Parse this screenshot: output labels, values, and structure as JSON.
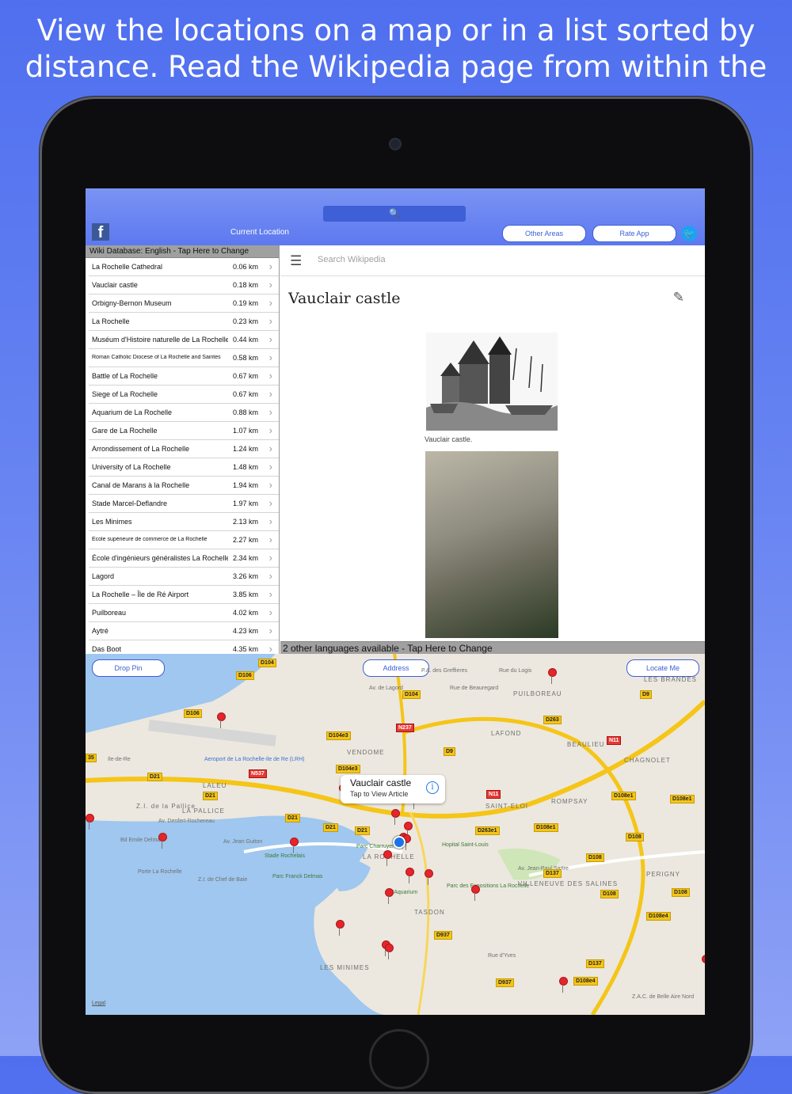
{
  "promo": {
    "line1": "View the locations on a map or in a list sorted by",
    "line2": "distance. Read the Wikipedia page from within the app."
  },
  "toolbar": {
    "facebook_icon": "f",
    "search_glyph": "🔍",
    "current_location": "Current Location",
    "other_areas": "Other Areas",
    "rate_app": "Rate App",
    "twitter_icon": "🐦"
  },
  "list": {
    "database_bar": "Wiki Database: English - Tap Here to Change",
    "items": [
      {
        "name": "La Rochelle Cathedral",
        "distance": "0.06 km"
      },
      {
        "name": "Vauclair castle",
        "distance": "0.18 km"
      },
      {
        "name": "Orbigny-Bernon Museum",
        "distance": "0.19 km"
      },
      {
        "name": "La Rochelle",
        "distance": "0.23 km"
      },
      {
        "name": "Muséum d'Histoire naturelle de La Rochelle",
        "distance": "0.44 km"
      },
      {
        "name": "Roman Catholic Diocese of La Rochelle and Saintes",
        "distance": "0.58 km",
        "small": true
      },
      {
        "name": "Battle of La Rochelle",
        "distance": "0.67 km"
      },
      {
        "name": "Siege of La Rochelle",
        "distance": "0.67 km"
      },
      {
        "name": "Aquarium de La Rochelle",
        "distance": "0.88 km"
      },
      {
        "name": "Gare de La Rochelle",
        "distance": "1.07 km"
      },
      {
        "name": "Arrondissement of La Rochelle",
        "distance": "1.24 km"
      },
      {
        "name": "University of La Rochelle",
        "distance": "1.48 km"
      },
      {
        "name": "Canal de Marans à la Rochelle",
        "distance": "1.94 km"
      },
      {
        "name": "Stade Marcel-Deflandre",
        "distance": "1.97 km"
      },
      {
        "name": "Les Minimes",
        "distance": "2.13 km"
      },
      {
        "name": "École supérieure de commerce de La Rochelle",
        "distance": "2.27 km",
        "small": true
      },
      {
        "name": "École d'ingénieurs généralistes La Rochelle",
        "distance": "2.34 km"
      },
      {
        "name": "Lagord",
        "distance": "3.26 km"
      },
      {
        "name": "La Rochelle – Île de Ré Airport",
        "distance": "3.85 km"
      },
      {
        "name": "Puilboreau",
        "distance": "4.02 km"
      },
      {
        "name": "Aytré",
        "distance": "4.23 km"
      },
      {
        "name": "Das Boot",
        "distance": "4.35 km"
      }
    ]
  },
  "wiki": {
    "menu_icon": "☰",
    "search_placeholder": "Search Wikipedia",
    "title": "Vauclair castle",
    "edit_icon": "✎",
    "caption": "Vauclair castle.",
    "languages_bar": "2 other languages available - Tap Here to Change"
  },
  "map": {
    "drop_pin": "Drop Pin",
    "address": "Address",
    "locate_me": "Locate Me",
    "callout_title": "Vauclair castle",
    "callout_subtitle": "Tap to View Article",
    "info_icon": "i",
    "legal": "Legal",
    "places": [
      "PUILBOREAU",
      "LAFOND",
      "VENDOME",
      "CHAGNOLET",
      "ROMPSAY",
      "SAINT-ELOI",
      "LA ROCHELLE",
      "TASDON",
      "LES MINIMES",
      "PERIGNY",
      "VILLENEUVE DES SALINES",
      "LES BRANDES",
      "BEAULIEU",
      "LALEU",
      "LA PALLICE",
      "Z.I. de la Pallice",
      "Porte La Rochelle",
      "Z.I. de Chef de Baie",
      "Aeroport de La Rochelle-Ile de Re (LRH)",
      "Stade Rochelais",
      "Parc Franck Delmas",
      "L'Aquarium",
      "Parc Charruyer",
      "Hopital Saint-Louis",
      "Parc des Expositions La Rochelle",
      "Ile-de-Re",
      "Bd Emile Delmas",
      "Av. Denfert-Rochereau",
      "Av. Jean Guiton",
      "Av. Jean-Paul Sartre",
      "Rue du Logis",
      "Rue d'Yves",
      "Av. de Lagord",
      "Rue de Beauregard",
      "P.A. des Greffieres",
      "Z.A.C. de Belle Aire Nord"
    ],
    "roads": [
      "D104",
      "D106",
      "D106",
      "D104",
      "N237",
      "D104e3",
      "D9",
      "D104e3",
      "N537",
      "D21",
      "D21",
      "D21",
      "D21",
      "D21",
      "N11",
      "D263e1",
      "D108e1",
      "D108e1",
      "D108e1",
      "D108",
      "D108",
      "D108",
      "D108",
      "D137",
      "D137",
      "D937",
      "D937",
      "D108e4",
      "D108e4",
      "D9",
      "D263",
      "N11",
      "35"
    ]
  }
}
